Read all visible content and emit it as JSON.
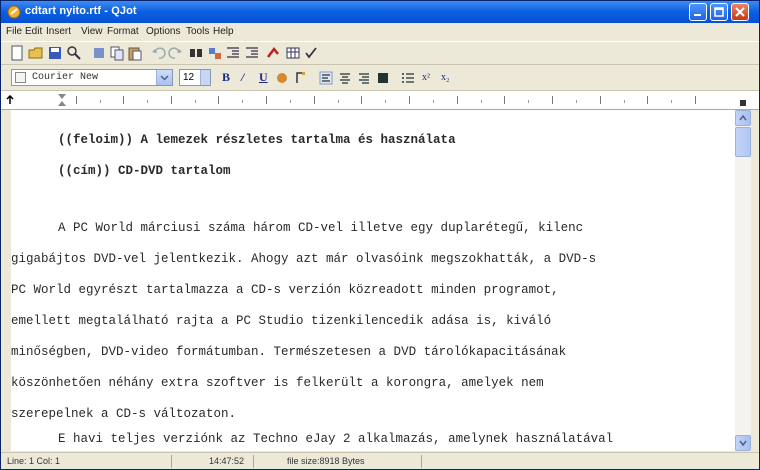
{
  "window": {
    "title": "cdtart nyito.rtf - QJot"
  },
  "menu": [
    "File",
    "Edit",
    "Insert",
    "View",
    "Format",
    "Options",
    "Tools",
    "Help"
  ],
  "format_bar": {
    "font": "Courier New",
    "size": "12",
    "bold_label": "B",
    "italic_label": "/",
    "underline_label": "U",
    "superscript_label": "x²",
    "subscript_label": "x₂"
  },
  "document": {
    "lines": [
      "((feloim)) A lemezek részletes tartalma és használata",
      "((cím)) CD-DVD tartalom",
      "A PC World márciusi száma három CD-vel illetve egy duplarétegű, kilenc",
      "gigabájtos DVD-vel jelentkezik. Ahogy azt már olvasóink megszokhatták, a DVD-s",
      "PC World egyrészt tartalmazza a CD-s verzión közreadott minden programot,",
      "emellett megtalálható rajta a PC Studio tizenkilencedik adása is, kiváló",
      "minőségben, DVD-video formátumban. Természetesen a DVD tárolókapacitásának",
      "köszönhetően néhány extra szoftver is felkerült a korongra, amelyek nem",
      "szerepelnek a CD-s változaton.",
      "E havi teljes verziónk az Techno eJay 2 alkalmazás, amelynek használatával"
    ]
  },
  "status": {
    "position": "Line: 1 Col: 1",
    "time": "14:47:52",
    "file_size": "file size:8918 Bytes"
  }
}
